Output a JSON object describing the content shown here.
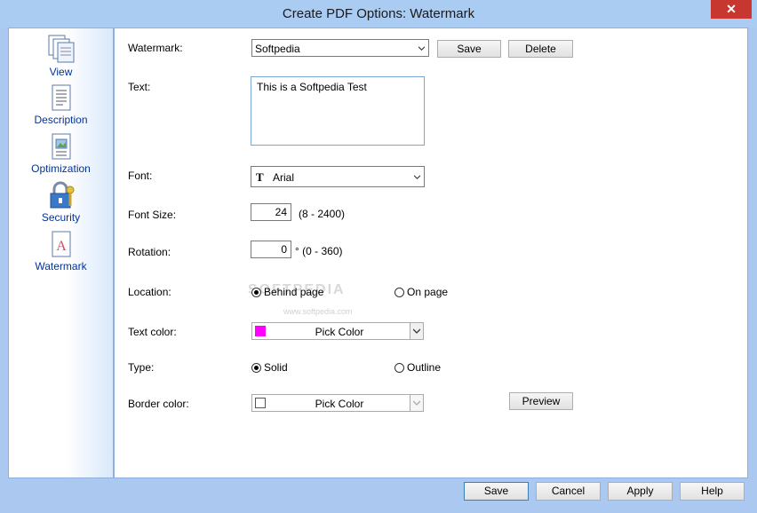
{
  "window": {
    "title": "Create PDF Options: Watermark",
    "close": "✕"
  },
  "sidebar": {
    "items": [
      {
        "label": "View"
      },
      {
        "label": "Description"
      },
      {
        "label": "Optimization"
      },
      {
        "label": "Security"
      },
      {
        "label": "Watermark"
      }
    ]
  },
  "form": {
    "watermark": {
      "label": "Watermark:",
      "value": "Softpedia",
      "save": "Save",
      "delete": "Delete"
    },
    "text": {
      "label": "Text:",
      "value": "This is a Softpedia Test"
    },
    "font": {
      "label": "Font:",
      "value": "Arial"
    },
    "font_size": {
      "label": "Font Size:",
      "value": "24",
      "range": "(8  -  2400)"
    },
    "rotation": {
      "label": "Rotation:",
      "value": "0",
      "range": "° (0  -  360)"
    },
    "location": {
      "label": "Location:",
      "opt1": "Behind page",
      "opt2": "On page",
      "selected": "Behind page"
    },
    "text_color": {
      "label": "Text color:",
      "button": "Pick Color",
      "color": "#ff00ff"
    },
    "type": {
      "label": "Type:",
      "opt1": "Solid",
      "opt2": "Outline",
      "selected": "Solid"
    },
    "border_color": {
      "label": "Border color:",
      "button": "Pick Color",
      "color": "#ffffff",
      "preview": "Preview"
    }
  },
  "watermark_overlay": {
    "logo": "SOFTPEDIA",
    "url": "www.softpedia.com"
  },
  "footer": {
    "save": "Save",
    "cancel": "Cancel",
    "apply": "Apply",
    "help": "Help"
  }
}
